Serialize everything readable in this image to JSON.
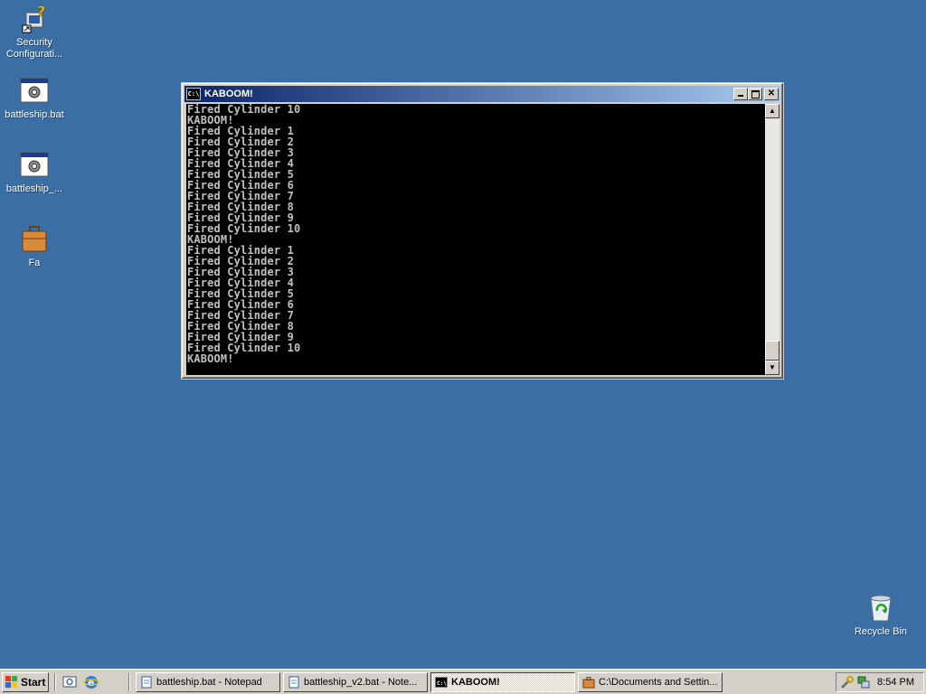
{
  "desktop": {
    "icons": [
      {
        "label": "Security Configurati...",
        "icon": "security-config-icon"
      },
      {
        "label": "battleship.bat",
        "icon": "batch-file-icon"
      },
      {
        "label": "battleship_...",
        "icon": "batch-file-icon"
      },
      {
        "label": "Fa",
        "icon": "briefcase-icon"
      },
      {
        "label": "Recycle Bin",
        "icon": "recycle-bin-icon"
      }
    ]
  },
  "window": {
    "title": "KABOOM!",
    "icon_text": "C:\\",
    "console_lines": [
      "Fired Cylinder 10",
      "KABOOM!",
      "Fired Cylinder 1",
      "Fired Cylinder 2",
      "Fired Cylinder 3",
      "Fired Cylinder 4",
      "Fired Cylinder 5",
      "Fired Cylinder 6",
      "Fired Cylinder 7",
      "Fired Cylinder 8",
      "Fired Cylinder 9",
      "Fired Cylinder 10",
      "KABOOM!",
      "Fired Cylinder 1",
      "Fired Cylinder 2",
      "Fired Cylinder 3",
      "Fired Cylinder 4",
      "Fired Cylinder 5",
      "Fired Cylinder 6",
      "Fired Cylinder 7",
      "Fired Cylinder 8",
      "Fired Cylinder 9",
      "Fired Cylinder 10",
      "KABOOM!"
    ],
    "console_bg": "#000000",
    "console_fg": "#c0c0c0",
    "titlebar_color": "#0a246a"
  },
  "taskbar": {
    "start_label": "Start",
    "tasks": [
      {
        "label": "battleship.bat - Notepad",
        "active": false
      },
      {
        "label": "battleship_v2.bat - Note...",
        "active": false
      },
      {
        "label": "KABOOM!",
        "active": true
      },
      {
        "label": "C:\\Documents and Settin...",
        "active": false
      }
    ],
    "clock": "8:54 PM"
  },
  "colors": {
    "desktop": "#3a6ea5",
    "chrome": "#d4d0c8"
  }
}
